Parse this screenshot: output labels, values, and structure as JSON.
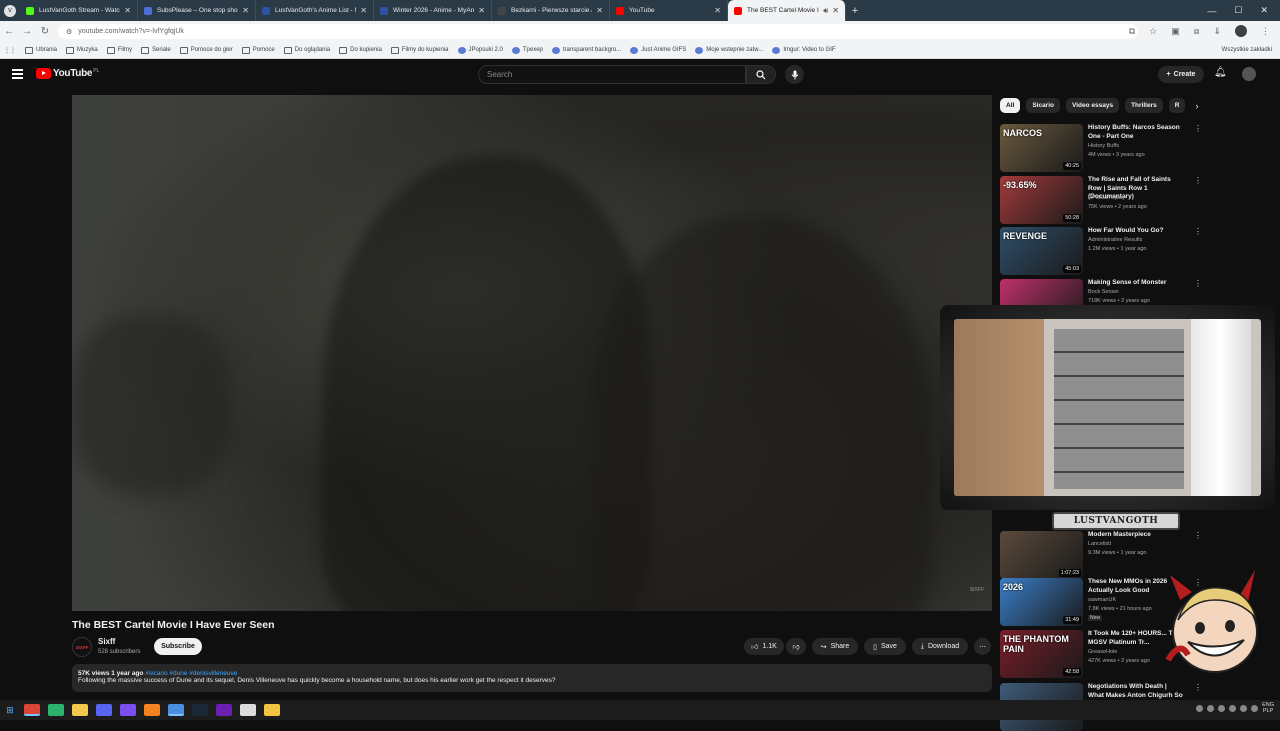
{
  "browser": {
    "tabs": [
      {
        "title": "LustVanGoth Stream - Watch L",
        "color": "#53fc18"
      },
      {
        "title": "SubsPlease – One stop shop fo",
        "color": "#4a6fd6"
      },
      {
        "title": "LustVanGoth's Anime List - My",
        "color": "#2e51a2"
      },
      {
        "title": "Winter 2026 - Anime - MyAnim",
        "color": "#2e51a2"
      },
      {
        "title": "Bezkarni - Pierwsze starcie / Th",
        "color": "#444444"
      },
      {
        "title": "YouTube",
        "color": "#ff0000"
      },
      {
        "title": "The BEST Cartel Movie I Ha",
        "color": "#ff0000"
      }
    ],
    "url": "youtube.com/watch?v=-lvfYgfqjUk",
    "bookmarks": [
      "Ubrania",
      "Muzyka",
      "Filmy",
      "Seriale",
      "Pomoce do gier",
      "Pomoce",
      "Do oglądania",
      "Do kupienia",
      "Filmy do kupienia",
      "JPopsuki 2.0",
      "Tpexep",
      "transparent backgro...",
      "Just Anime GIFS",
      "Moje wstepnie zatw...",
      "Imgur: Video to GIF"
    ],
    "bookmarks_all": "Wszystkie zakładki"
  },
  "youtube": {
    "logo": "YouTube",
    "logo_region": "PL",
    "search_placeholder": "Search",
    "create_label": "Create"
  },
  "video": {
    "watermark": "SIXFF",
    "title": "The BEST Cartel Movie I Have Ever Seen",
    "channel": "Sixff",
    "channel_avatar_text": "SIXFF",
    "subscribers": "528 subscribers",
    "subscribe_label": "Subscribe",
    "likes": "1.1K",
    "share_label": "Share",
    "save_label": "Save",
    "download_label": "Download",
    "views_date": "57K views  1 year ago",
    "tags": "#sicario #dune #denisvilleneuve",
    "description": "Following the massive success of Dune and its sequel, Denis Villeneuve has quickly become a household name, but does his earlier work get the respect it deserves?"
  },
  "sidebar": {
    "chips": [
      "All",
      "Sicario",
      "Video essays",
      "Thrillers",
      "R"
    ],
    "recommendations": [
      {
        "title": "History Buffs: Narcos Season One - Part One",
        "channel": "History Buffs",
        "stats": "4M views • 3 years ago",
        "duration": "40:25",
        "thumb_text": "NARCOS",
        "thumb_color": "#6b5a3e"
      },
      {
        "title": "The Rise and Fall of Saints Row | Saints Row 1 (Documentary)",
        "channel": "RPGGameplay",
        "stats": "75K views • 2 years ago",
        "duration": "50:28",
        "thumb_text": "-93.65%",
        "thumb_color": "#a33b3b"
      },
      {
        "title": "How Far Would You Go?",
        "channel": "Administrative Results",
        "stats": "1.2M views • 1 year ago",
        "duration": "45:03",
        "thumb_text": "REVENGE",
        "thumb_color": "#2f4f6b"
      },
      {
        "title": "Making Sense of Monster",
        "channel": "Bock Sensei",
        "stats": "718K views • 2 years ago",
        "duration": "",
        "thumb_text": "",
        "thumb_color": "#c0306a"
      },
      {
        "title": "Modern Masterpiece",
        "channel": "Lancelisti",
        "stats": "9.3M views • 1 year ago",
        "duration": "1:07:23",
        "thumb_text": "",
        "thumb_color": "#5b4a3c"
      },
      {
        "title": "These New MMOs in 2026 Actually Look Good",
        "channel": "sawmanUK",
        "stats": "7.8K views • 21 hours ago",
        "duration": "31:49",
        "thumb_text": "2026",
        "thumb_color": "#3a7fc9",
        "badge": "New"
      },
      {
        "title": "It Took Me 120+ HOURS... The MGSV Platinum Tr...",
        "channel": "GreaseHole",
        "stats": "427K views • 2 years ago",
        "duration": "42:58",
        "thumb_text": "THE PHANTOM PAIN",
        "thumb_color": "#7a1e2a"
      },
      {
        "title": "Negotiations With Death | What Makes Anton Chigurh So ...",
        "channel": "",
        "stats": "",
        "duration": "",
        "thumb_text": "",
        "thumb_color": "#3f5b7a"
      }
    ]
  },
  "overlay": {
    "streamer_name": "LUSTVANGOTH"
  },
  "taskbar": {
    "lang": "ENG",
    "layout": "PLP"
  }
}
